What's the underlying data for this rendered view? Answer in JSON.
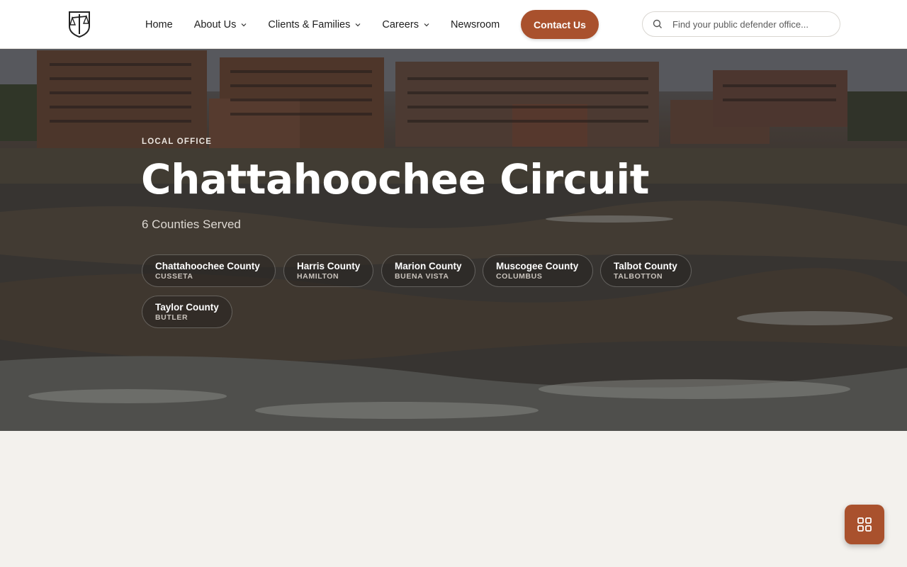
{
  "header": {
    "nav": [
      {
        "label": "Home",
        "has_dropdown": false
      },
      {
        "label": "About Us",
        "has_dropdown": true
      },
      {
        "label": "Clients & Families",
        "has_dropdown": true
      },
      {
        "label": "Careers",
        "has_dropdown": true
      },
      {
        "label": "Newsroom",
        "has_dropdown": false
      }
    ],
    "contact_label": "Contact Us",
    "search_placeholder": "Find your public defender office..."
  },
  "hero": {
    "eyebrow": "LOCAL OFFICE",
    "title": "Chattahoochee Circuit",
    "subtitle": "6 Counties Served",
    "counties": [
      {
        "name": "Chattahoochee County",
        "seat": "CUSSETA"
      },
      {
        "name": "Harris County",
        "seat": "HAMILTON"
      },
      {
        "name": "Marion County",
        "seat": "BUENA VISTA"
      },
      {
        "name": "Muscogee County",
        "seat": "COLUMBUS"
      },
      {
        "name": "Talbot County",
        "seat": "TALBOTTON"
      },
      {
        "name": "Taylor County",
        "seat": "BUTLER"
      }
    ]
  },
  "icons": {
    "logo": "scales-shield-logo-icon",
    "search": "search-icon",
    "dropdown": "chevron-down-icon",
    "fab": "grid-icon"
  },
  "colors": {
    "accent": "#a9512d",
    "page_background": "#f3f1ed",
    "header_background": "#ffffff"
  }
}
